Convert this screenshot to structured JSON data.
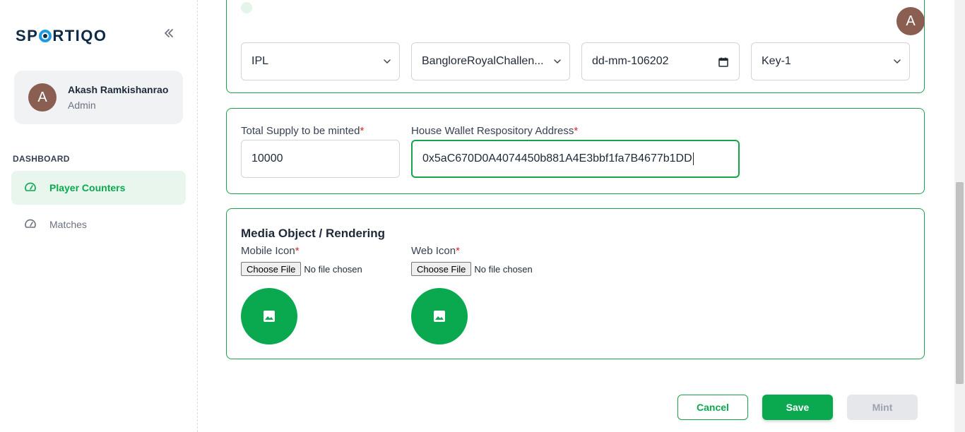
{
  "brand": {
    "name_prefix": "SP",
    "name_suffix": "RTIQO"
  },
  "profile": {
    "initial": "A",
    "name": "Akash Ramkishanrao",
    "role": "Admin"
  },
  "nav": {
    "heading": "DASHBOARD",
    "items": [
      {
        "label": "Player Counters",
        "icon": "speedometer-icon",
        "active": true
      },
      {
        "label": "Matches",
        "icon": "speedometer-icon",
        "active": false
      }
    ]
  },
  "header": {
    "avatar_initial": "A"
  },
  "section1": {
    "selects": [
      {
        "value": "IPL"
      },
      {
        "value": "BangloreRoyalChallen..."
      },
      {
        "value": "dd-mm-106202"
      },
      {
        "value": "Key-1"
      }
    ]
  },
  "section2": {
    "total_supply_label": "Total Supply to be minted",
    "total_supply_value": "10000",
    "wallet_label": "House Wallet Respository Address",
    "wallet_value": "0x5aC670D0A4074450b881A4E3bbf1fa7B4677b1DD"
  },
  "section3": {
    "title": "Media Object / Rendering",
    "mobile_icon_label": "Mobile Icon",
    "web_icon_label": "Web Icon",
    "choose_file_label": "Choose File",
    "no_file_label": "No file chosen"
  },
  "actions": {
    "cancel": "Cancel",
    "save": "Save",
    "mint": "Mint"
  },
  "colors": {
    "accent": "#0aa84f",
    "border": "#16a34a",
    "avatar": "#8b5e52",
    "required": "#dc2626"
  }
}
